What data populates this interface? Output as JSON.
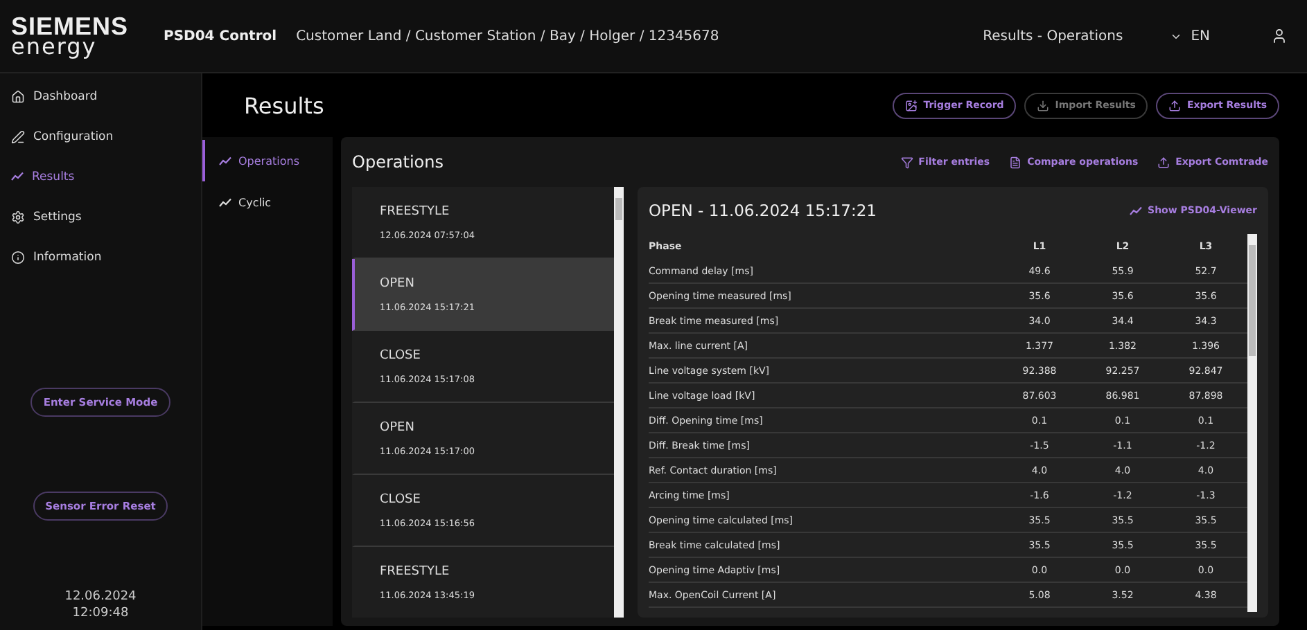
{
  "header": {
    "logo_top": "SIEMENS",
    "logo_bottom": "energy",
    "app_title": "PSD04 Control",
    "breadcrumb": "Customer Land / Customer Station / Bay / Holger / 12345678",
    "page_label": "Results - Operations",
    "language": "EN"
  },
  "sidebar": {
    "items": [
      {
        "label": "Dashboard",
        "kind": "home",
        "selected": false
      },
      {
        "label": "Configuration",
        "kind": "pen",
        "selected": false
      },
      {
        "label": "Results",
        "kind": "trend",
        "selected": true
      },
      {
        "label": "Settings",
        "kind": "gear",
        "selected": false
      },
      {
        "label": "Information",
        "kind": "info",
        "selected": false
      }
    ],
    "buttons": [
      "Enter Service Mode",
      "Sensor Error Reset"
    ],
    "date": "12.06.2024",
    "time": "12:09:48"
  },
  "page_title": "Results",
  "actions": [
    {
      "label": "Trigger Record",
      "kind": "record",
      "disabled": false
    },
    {
      "label": "Import Results",
      "kind": "download",
      "disabled": true
    },
    {
      "label": "Export Results",
      "kind": "upload",
      "disabled": false
    }
  ],
  "subnav": [
    {
      "label": "Operations",
      "selected": true
    },
    {
      "label": "Cyclic",
      "selected": false
    }
  ],
  "operations": {
    "title": "Operations",
    "tools": [
      {
        "label": "Filter entries",
        "kind": "filter"
      },
      {
        "label": "Compare operations",
        "kind": "list"
      },
      {
        "label": "Export Comtrade",
        "kind": "upload"
      }
    ],
    "entries": [
      {
        "type": "FREESTYLE",
        "date": "12.06.2024 07:57:04",
        "selected": false
      },
      {
        "type": "OPEN",
        "date": "11.06.2024 15:17:21",
        "selected": true
      },
      {
        "type": "CLOSE",
        "date": "11.06.2024 15:17:08",
        "selected": false
      },
      {
        "type": "OPEN",
        "date": "11.06.2024 15:17:00",
        "selected": false
      },
      {
        "type": "CLOSE",
        "date": "11.06.2024 15:16:56",
        "selected": false
      },
      {
        "type": "FREESTYLE",
        "date": "11.06.2024 13:45:19",
        "selected": false
      }
    ],
    "detail": {
      "title": "OPEN - 11.06.2024 15:17:21",
      "viewer_link": "Show PSD04-Viewer",
      "columns": [
        "Phase",
        "L1",
        "L2",
        "L3"
      ],
      "rows": [
        {
          "label": "Command delay [ms]",
          "values": [
            "49.6",
            "55.9",
            "52.7"
          ]
        },
        {
          "label": "Opening time measured [ms]",
          "values": [
            "35.6",
            "35.6",
            "35.6"
          ]
        },
        {
          "label": "Break time measured [ms]",
          "values": [
            "34.0",
            "34.4",
            "34.3"
          ]
        },
        {
          "label": "Max. line current [A]",
          "values": [
            "1.377",
            "1.382",
            "1.396"
          ]
        },
        {
          "label": "Line voltage system [kV]",
          "values": [
            "92.388",
            "92.257",
            "92.847"
          ]
        },
        {
          "label": "Line voltage load [kV]",
          "values": [
            "87.603",
            "86.981",
            "87.898"
          ]
        },
        {
          "label": "Diff. Opening time [ms]",
          "values": [
            "0.1",
            "0.1",
            "0.1"
          ]
        },
        {
          "label": "Diff. Break time [ms]",
          "values": [
            "-1.5",
            "-1.1",
            "-1.2"
          ]
        },
        {
          "label": "Ref. Contact duration [ms]",
          "values": [
            "4.0",
            "4.0",
            "4.0"
          ]
        },
        {
          "label": "Arcing time [ms]",
          "values": [
            "-1.6",
            "-1.2",
            "-1.3"
          ]
        },
        {
          "label": "Opening time calculated [ms]",
          "values": [
            "35.5",
            "35.5",
            "35.5"
          ]
        },
        {
          "label": "Break time calculated [ms]",
          "values": [
            "35.5",
            "35.5",
            "35.5"
          ]
        },
        {
          "label": "Opening time Adaptiv [ms]",
          "values": [
            "0.0",
            "0.0",
            "0.0"
          ]
        },
        {
          "label": "Max. OpenCoil Current [A]",
          "values": [
            "5.08",
            "3.52",
            "4.38"
          ]
        }
      ]
    }
  }
}
